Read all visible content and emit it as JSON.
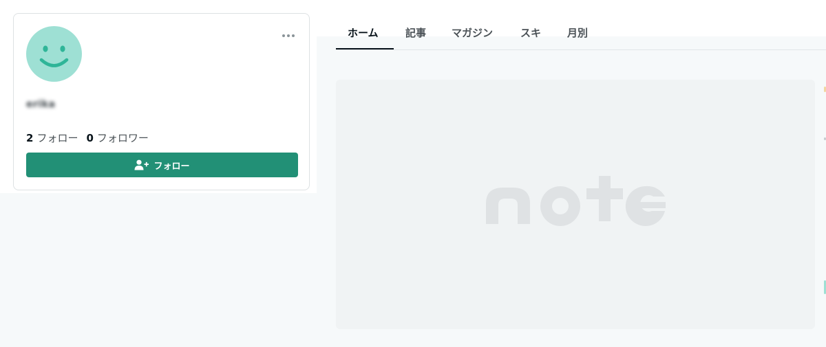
{
  "profile": {
    "name": "erika",
    "more_label": "…",
    "stats": [
      {
        "count": "2",
        "label": "フォロー"
      },
      {
        "count": "0",
        "label": "フォロワー"
      }
    ],
    "follow_button_label": "フォロー"
  },
  "tabs": [
    {
      "label": "ホーム",
      "active": true
    },
    {
      "label": "記事",
      "active": false
    },
    {
      "label": "マガジン",
      "active": false
    },
    {
      "label": "スキ",
      "active": false
    },
    {
      "label": "月別",
      "active": false
    }
  ],
  "placeholder": {
    "logo": "note"
  },
  "colors": {
    "accent": "#229076",
    "avatar": "#9ee0d4",
    "avatar_face": "#2fb598",
    "logo": "#dfe2e4"
  }
}
